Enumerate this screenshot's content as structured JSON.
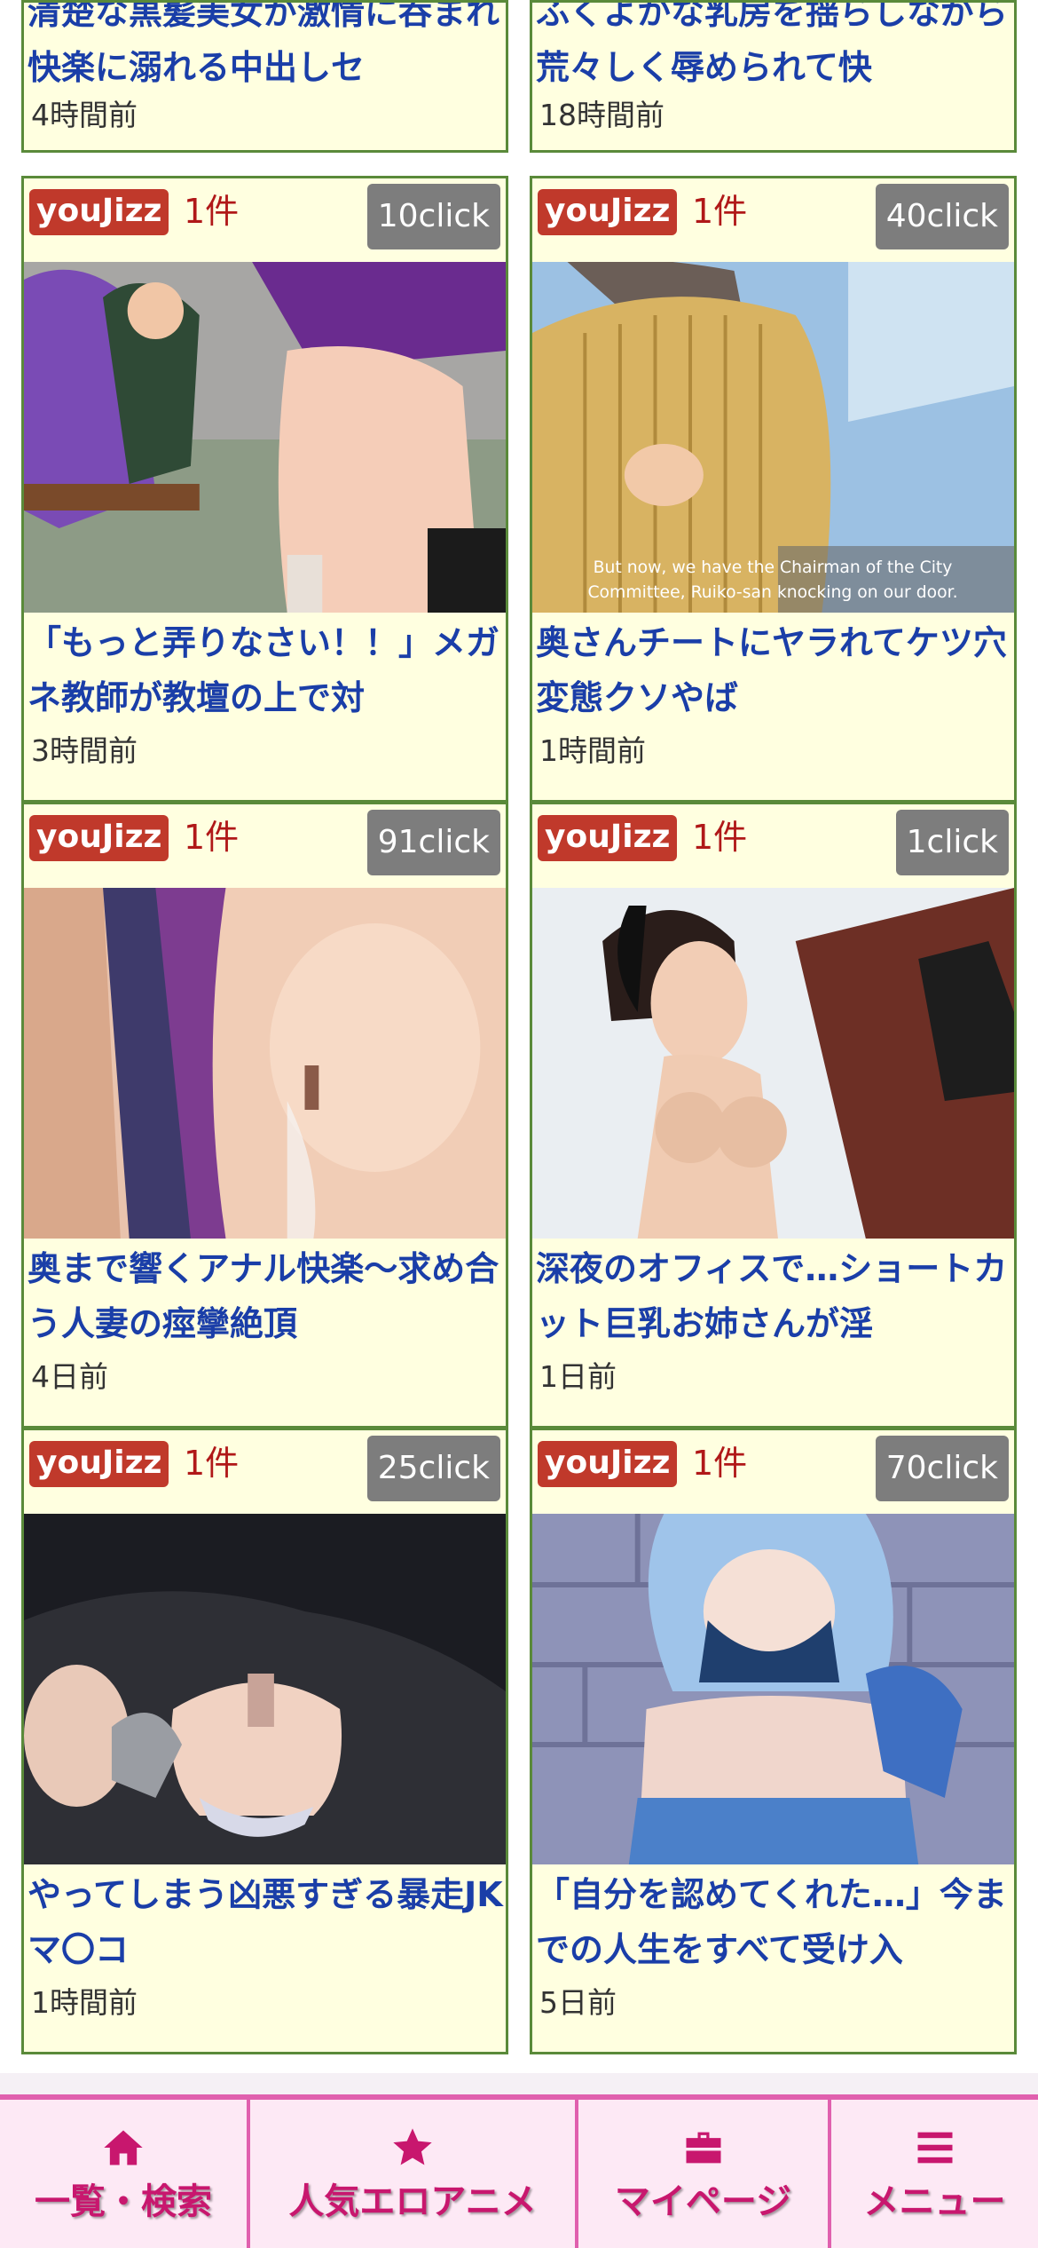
{
  "colors": {
    "card_bg": "#ffffe0",
    "card_border": "#5a8a3a",
    "source_badge": "#c0392b",
    "count_text": "#b01818",
    "click_badge": "#7d7d7d",
    "title_text": "#1a3ea8",
    "nav_accent": "#e060ae",
    "nav_text": "#c8176e"
  },
  "top_cards": [
    {
      "title": "清楚な黒髪美女が激情に呑まれ快楽に溺れる中出しセ",
      "time": "4時間前"
    },
    {
      "title": "ふくよかな乳房を揺らしながら荒々しく辱められて快",
      "time": "18時間前"
    }
  ],
  "cards": [
    {
      "source": "youJizz",
      "count": "1件",
      "clicks": "10click",
      "title": "「もっと弄りなさい！！」メガネ教師が教壇の上で対",
      "time": "3時間前"
    },
    {
      "source": "youJizz",
      "count": "1件",
      "clicks": "40click",
      "title": "奥さんチートにヤラれてケツ穴変態クソやば",
      "time": "1時間前",
      "subtitle_line1": "But now, we have the Chairman of the City",
      "subtitle_line2": "Committee, Ruiko-san knocking on our door."
    },
    {
      "source": "youJizz",
      "count": "1件",
      "clicks": "91click",
      "title": "奥まで響くアナル快楽〜求め合う人妻の痙攣絶頂",
      "time": "4日前"
    },
    {
      "source": "youJizz",
      "count": "1件",
      "clicks": "1click",
      "title": "深夜のオフィスで…ショートカット巨乳お姉さんが淫",
      "time": "1日前"
    },
    {
      "source": "youJizz",
      "count": "1件",
      "clicks": "25click",
      "title": "やってしまう凶悪すぎる暴走JKマ〇コ",
      "time": "1時間前"
    },
    {
      "source": "youJizz",
      "count": "1件",
      "clicks": "70click",
      "title": "「自分を認めてくれた…」今までの人生をすべて受け入",
      "time": "5日前"
    }
  ],
  "nav": [
    {
      "icon": "home-icon",
      "label": "一覧・検索"
    },
    {
      "icon": "star-icon",
      "label": "人気エロアニメ"
    },
    {
      "icon": "briefcase-icon",
      "label": "マイページ"
    },
    {
      "icon": "menu-icon",
      "label": "メニュー"
    }
  ]
}
